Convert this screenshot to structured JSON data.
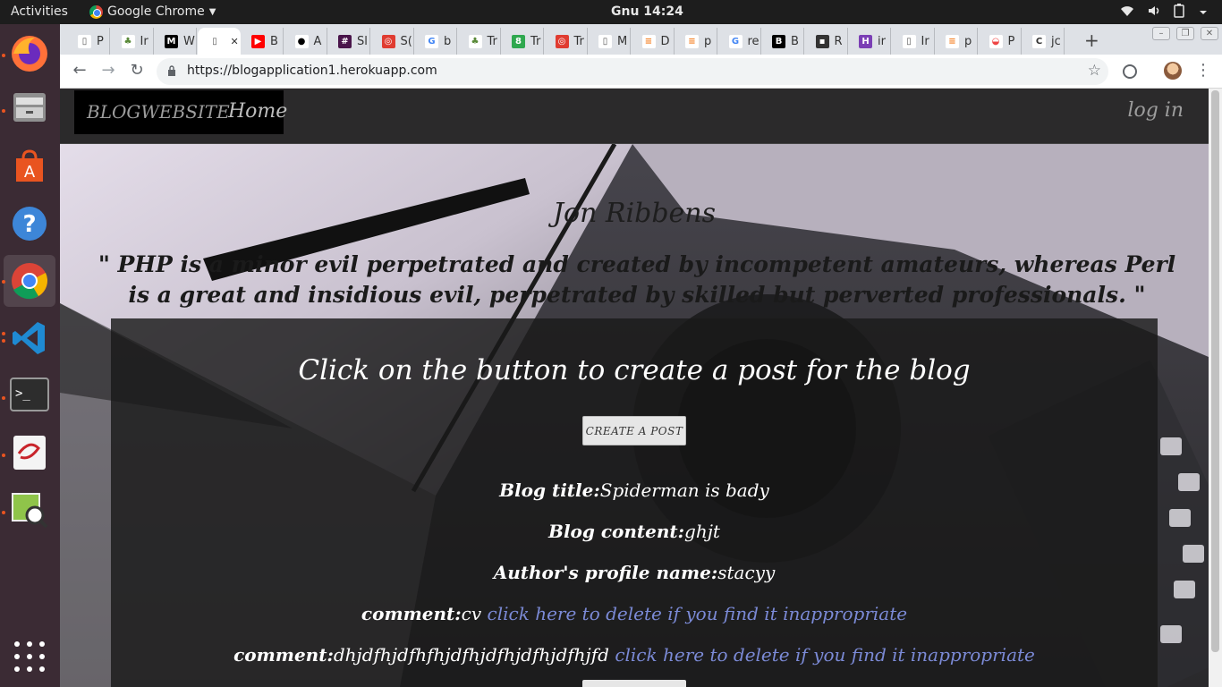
{
  "system": {
    "activities_label": "Activities",
    "app_name": "Google Chrome",
    "clock": "Gnu 14:24"
  },
  "dock": {
    "items": [
      "firefox",
      "files",
      "software-center",
      "help",
      "chrome",
      "vscode",
      "terminal",
      "evince",
      "image-viewer"
    ],
    "active": "chrome"
  },
  "tabs": [
    {
      "label": "P",
      "icon": "doc"
    },
    {
      "label": "Ir",
      "icon": "tree"
    },
    {
      "label": "W",
      "icon": "medium"
    },
    {
      "label": "",
      "icon": "doc",
      "active": true
    },
    {
      "label": "B",
      "icon": "youtube"
    },
    {
      "label": "A",
      "icon": "github"
    },
    {
      "label": "Sl",
      "icon": "slack"
    },
    {
      "label": "S(",
      "icon": "red-square"
    },
    {
      "label": "b",
      "icon": "google"
    },
    {
      "label": "Tr",
      "icon": "tree"
    },
    {
      "label": "Tr",
      "icon": "green-tag"
    },
    {
      "label": "Tr",
      "icon": "red-square"
    },
    {
      "label": "M",
      "icon": "doc"
    },
    {
      "label": "D",
      "icon": "stack"
    },
    {
      "label": "p",
      "icon": "stack"
    },
    {
      "label": "re",
      "icon": "google"
    },
    {
      "label": "B",
      "icon": "b-box"
    },
    {
      "label": "R",
      "icon": "film"
    },
    {
      "label": "ir",
      "icon": "h-box"
    },
    {
      "label": "Ir",
      "icon": "doc"
    },
    {
      "label": "p",
      "icon": "stack"
    },
    {
      "label": "P",
      "icon": "rainbow"
    },
    {
      "label": "jc",
      "icon": "c-box"
    }
  ],
  "toolbar": {
    "url": "https://blogapplication1.herokuapp.com"
  },
  "site": {
    "brand": "BLOGWEBSITE",
    "home": "Home",
    "login": "log in",
    "author": "Jon Ribbens",
    "quote": "\" PHP is a minor evil perpetrated and created by incompetent amateurs, whereas Perl is a great and insidious evil, perpetrated by skilled but perverted professionals. \"",
    "panel_heading": "Click on the button to create a post for the blog",
    "create_button": "CREATE A POST",
    "post": {
      "title_label": "Blog title:",
      "title_value": "Spiderman is bady",
      "content_label": "Blog content:",
      "content_value": "ghjt",
      "author_label": "Author's profile name:",
      "author_value": "stacyy",
      "comments": [
        {
          "label": "comment:",
          "text": "cv",
          "delete_link": "click here to delete if you find it inappropriate"
        },
        {
          "label": "comment:",
          "text": "dhjdfhjdfhfhjdfhjdfhjdfhjdfhjfd",
          "delete_link": "click here to delete if you find it inappropriate"
        }
      ]
    }
  }
}
